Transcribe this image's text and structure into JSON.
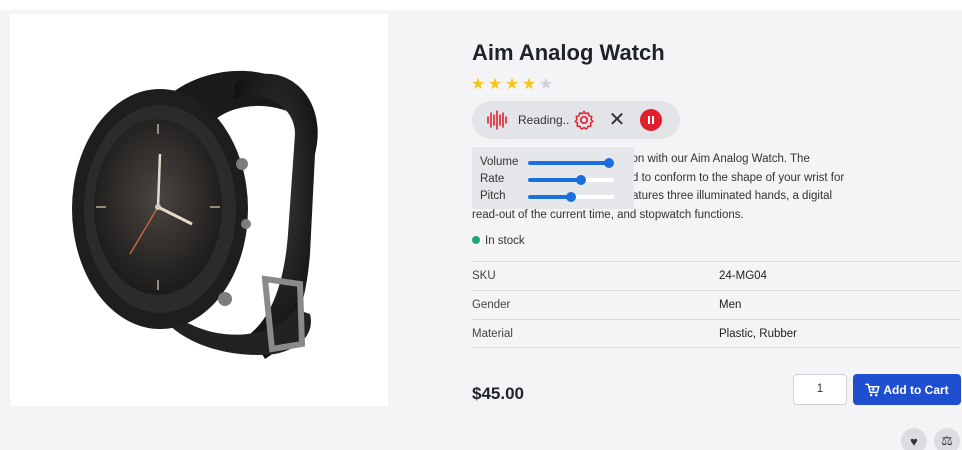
{
  "product": {
    "title": "Aim Analog Watch",
    "rating": {
      "value": 4,
      "max": 5,
      "filled_color": "#f4c51c",
      "empty_color": "#cdd3dd"
    },
    "description_lines": [
      "Stay uncompromised in the office or at the finish line of your competition with our Aim Analog Watch. The",
      "long, flexible rubber strap is designed to conform to the shape of your wrist for",
      "a comfortable fit. The timepiece features three illuminated hands, a digital",
      "read-out of the current time, and stopwatch functions."
    ],
    "description_visible_lines": [
      "tition with our Aim Analog Watch. The",
      "d to conform to the shape of your wrist for",
      "atures three illuminated hands, a digital",
      "read-out of the current time, and stopwatch functions."
    ],
    "stock_status": "In stock",
    "stock_color": "#19a974",
    "specs": [
      {
        "key": "SKU",
        "value": "24-MG04"
      },
      {
        "key": "Gender",
        "value": "Men"
      },
      {
        "key": "Material",
        "value": "Plastic, Rubber"
      }
    ],
    "price": "$45.00",
    "quantity": "1",
    "add_to_cart_label": "Add to Cart",
    "image_alt": "watch-product-image"
  },
  "reader": {
    "status": "Reading..",
    "wave_icon": "soundwave-icon",
    "settings_icon": "gear-icon",
    "close_icon": "close-icon",
    "pause_icon": "pause-icon",
    "accent_color": "#e0202f",
    "settings": [
      {
        "label": "Volume",
        "level": 0.95
      },
      {
        "label": "Rate",
        "level": 0.62
      },
      {
        "label": "Pitch",
        "level": 0.5
      }
    ]
  },
  "actions": {
    "wishlist_icon": "heart-icon",
    "compare_icon": "scale-icon"
  },
  "colors": {
    "primary_button": "#1f4fcf",
    "slider": "#1a6fe0"
  }
}
